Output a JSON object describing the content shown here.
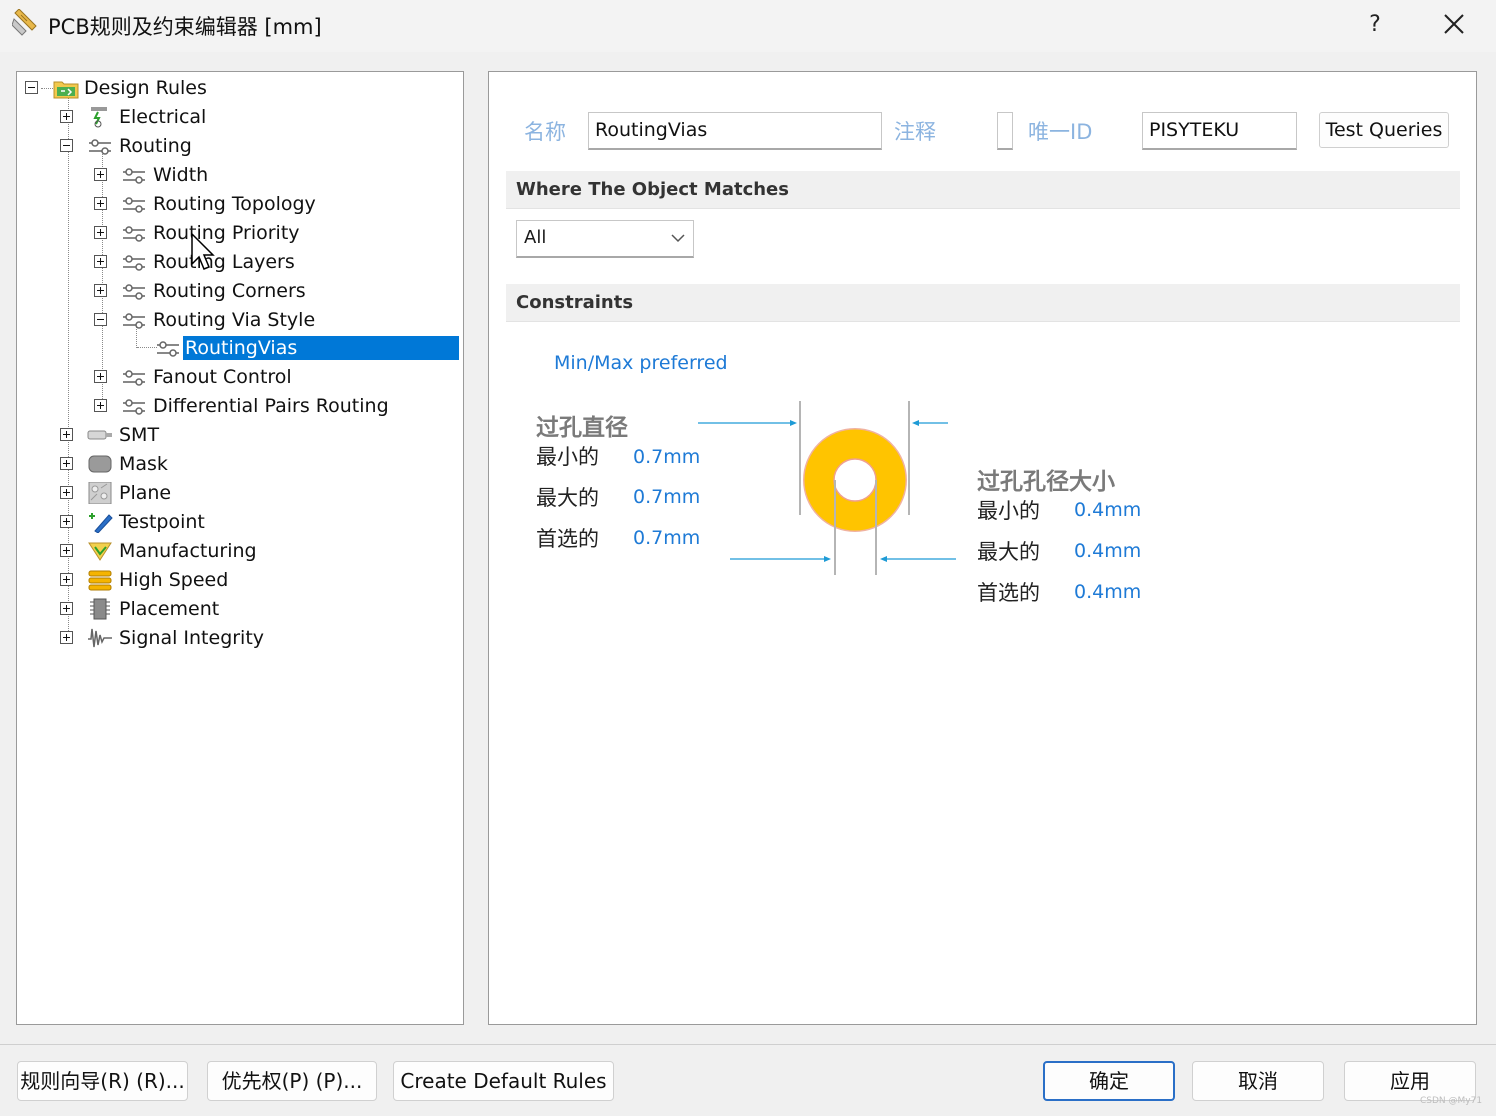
{
  "window": {
    "title": "PCB规则及约束编辑器 [mm]",
    "help_label": "?",
    "close_icon": "close-icon"
  },
  "tree": {
    "root": "Design Rules",
    "items": [
      {
        "label": "Design Rules",
        "icon": "folder-rules-icon",
        "expanded": true
      },
      {
        "label": "Electrical",
        "icon": "electrical-icon",
        "expanded": false
      },
      {
        "label": "Routing",
        "icon": "routing-icon",
        "expanded": true
      },
      {
        "label": "Width",
        "icon": "routing-icon",
        "expanded": false
      },
      {
        "label": "Routing Topology",
        "icon": "routing-icon",
        "expanded": false
      },
      {
        "label": "Routing Priority",
        "icon": "routing-icon",
        "expanded": false
      },
      {
        "label": "Routing Layers",
        "icon": "routing-icon",
        "expanded": false
      },
      {
        "label": "Routing Corners",
        "icon": "routing-icon",
        "expanded": false
      },
      {
        "label": "Routing Via Style",
        "icon": "routing-icon",
        "expanded": true
      },
      {
        "label": "RoutingVias",
        "icon": "routing-icon",
        "selected": true
      },
      {
        "label": "Fanout Control",
        "icon": "routing-icon",
        "expanded": false
      },
      {
        "label": "Differential Pairs Routing",
        "icon": "routing-icon",
        "expanded": false
      },
      {
        "label": "SMT",
        "icon": "smt-icon",
        "expanded": false
      },
      {
        "label": "Mask",
        "icon": "mask-icon",
        "expanded": false
      },
      {
        "label": "Plane",
        "icon": "plane-icon",
        "expanded": false
      },
      {
        "label": "Testpoint",
        "icon": "testpoint-icon",
        "expanded": false
      },
      {
        "label": "Manufacturing",
        "icon": "manufacturing-icon",
        "expanded": false
      },
      {
        "label": "High Speed",
        "icon": "high-speed-icon",
        "expanded": false
      },
      {
        "label": "Placement",
        "icon": "placement-icon",
        "expanded": false
      },
      {
        "label": "Signal Integrity",
        "icon": "signal-integrity-icon",
        "expanded": false
      }
    ]
  },
  "rule": {
    "name_label": "名称",
    "name_value": "RoutingVias",
    "comment_label": "注释",
    "comment_value": "",
    "unique_id_label": "唯一ID",
    "unique_id_value": "PISYTEKU",
    "test_queries_label": "Test Queries"
  },
  "match_section": {
    "title": "Where The Object Matches",
    "scope_selected": "All"
  },
  "constraints": {
    "title": "Constraints",
    "mode_link": "Min/Max preferred",
    "via_diameter": {
      "title": "过孔直径",
      "min_label": "最小的",
      "min_value": "0.7mm",
      "max_label": "最大的",
      "max_value": "0.7mm",
      "preferred_label": "首选的",
      "preferred_value": "0.7mm"
    },
    "via_hole": {
      "title": "过孔孔径大小",
      "min_label": "最小的",
      "min_value": "0.4mm",
      "max_label": "最大的",
      "max_value": "0.4mm",
      "preferred_label": "首选的",
      "preferred_value": "0.4mm"
    }
  },
  "buttons": {
    "rule_wizard": "规则向导(R) (R)...",
    "priorities": "优先权(P) (P)...",
    "create_default": "Create Default Rules",
    "ok": "确定",
    "cancel": "取消",
    "apply": "应用"
  },
  "watermark": "CSDN @My71",
  "colors": {
    "selection": "#0078d7",
    "link": "#1e7ad6",
    "via_ring": "#ffc400",
    "via_outline": "#f0b2a0",
    "dimension_arrow": "#1e9bd6"
  }
}
